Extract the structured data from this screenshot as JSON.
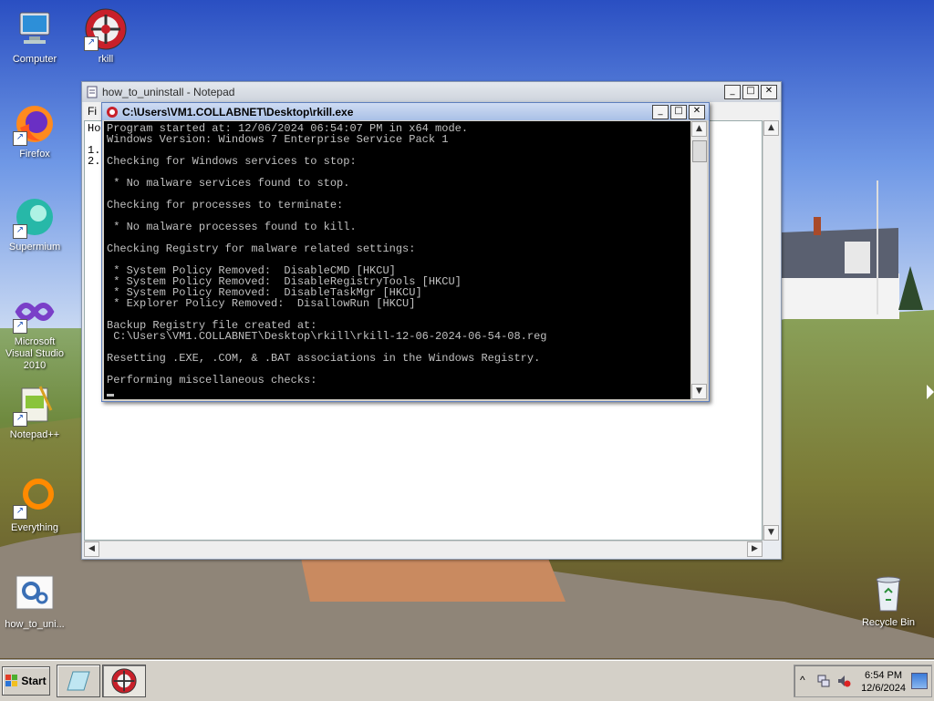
{
  "desktop": {
    "icons": [
      {
        "label": "Computer"
      },
      {
        "label": "rkill"
      },
      {
        "label": "Firefox"
      },
      {
        "label": "Supermium"
      },
      {
        "label": "Microsoft Visual Studio 2010"
      },
      {
        "label": "Notepad++"
      },
      {
        "label": "Everything"
      },
      {
        "label": "how_to_uni..."
      },
      {
        "label": "Recycle Bin"
      }
    ]
  },
  "notepad": {
    "title": "how_to_uninstall - Notepad",
    "menu_partial": "Fi",
    "text_partial": [
      "Ho",
      "",
      "1.",
      "2."
    ]
  },
  "console": {
    "title": "C:\\Users\\VM1.COLLABNET\\Desktop\\rkill.exe",
    "lines": [
      "Program started at: 12/06/2024 06:54:07 PM in x64 mode.",
      "Windows Version: Windows 7 Enterprise Service Pack 1",
      "",
      "Checking for Windows services to stop:",
      "",
      " * No malware services found to stop.",
      "",
      "Checking for processes to terminate:",
      "",
      " * No malware processes found to kill.",
      "",
      "Checking Registry for malware related settings:",
      "",
      " * System Policy Removed:  DisableCMD [HKCU]",
      " * System Policy Removed:  DisableRegistryTools [HKCU]",
      " * System Policy Removed:  DisableTaskMgr [HKCU]",
      " * Explorer Policy Removed:  DisallowRun [HKCU]",
      "",
      "Backup Registry file created at:",
      " C:\\Users\\VM1.COLLABNET\\Desktop\\rkill\\rkill-12-06-2024-06-54-08.reg",
      "",
      "Resetting .EXE, .COM, & .BAT associations in the Windows Registry.",
      "",
      "Performing miscellaneous checks:",
      ""
    ]
  },
  "window_buttons": {
    "minimize": "_",
    "maximize": "□",
    "close": "✕"
  },
  "taskbar": {
    "start_label": "Start",
    "clock_time": "6:54 PM",
    "clock_date": "12/6/2024",
    "tray_chevron": "^"
  }
}
